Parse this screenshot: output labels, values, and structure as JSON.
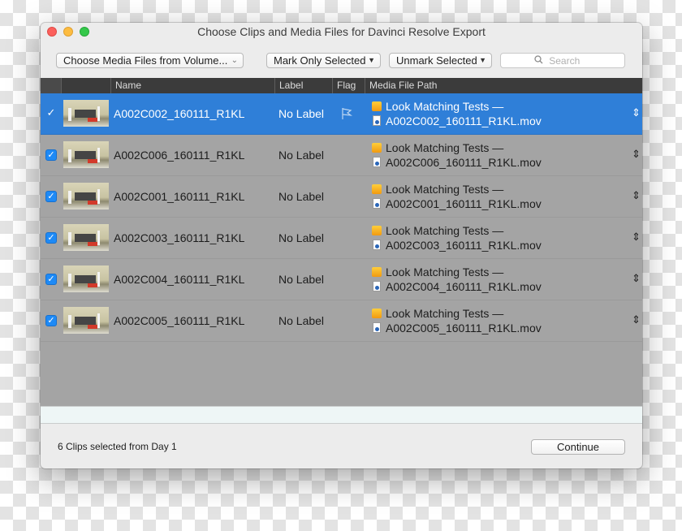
{
  "window": {
    "title": "Choose Clips and Media Files for Davinci Resolve Export"
  },
  "toolbar": {
    "media_dropdown_label": "Choose Media Files from Volume...",
    "mark_label": "Mark Only Selected",
    "unmark_label": "Unmark Selected",
    "search_placeholder": "Search"
  },
  "columns": {
    "name": "Name",
    "label": "Label",
    "flag": "Flag",
    "path": "Media File Path"
  },
  "rows": [
    {
      "name": "A002C002_160111_R1KL",
      "label": "No Label",
      "folder": "Look Matching Tests —",
      "file": "A002C002_160111_R1KL.mov",
      "checked": true,
      "selected": true
    },
    {
      "name": "A002C006_160111_R1KL",
      "label": "No Label",
      "folder": "Look Matching Tests —",
      "file": "A002C006_160111_R1KL.mov",
      "checked": true,
      "selected": false
    },
    {
      "name": "A002C001_160111_R1KL",
      "label": "No Label",
      "folder": "Look Matching Tests —",
      "file": "A002C001_160111_R1KL.mov",
      "checked": true,
      "selected": false
    },
    {
      "name": "A002C003_160111_R1KL",
      "label": "No Label",
      "folder": "Look Matching Tests —",
      "file": "A002C003_160111_R1KL.mov",
      "checked": true,
      "selected": false
    },
    {
      "name": "A002C004_160111_R1KL",
      "label": "No Label",
      "folder": "Look Matching Tests —",
      "file": "A002C004_160111_R1KL.mov",
      "checked": true,
      "selected": false
    },
    {
      "name": "A002C005_160111_R1KL",
      "label": "No Label",
      "folder": "Look Matching Tests —",
      "file": "A002C005_160111_R1KL.mov",
      "checked": true,
      "selected": false
    }
  ],
  "footer": {
    "status": "6 Clips selected from Day 1",
    "continue_label": "Continue"
  },
  "colors": {
    "selection": "#2f7fd8",
    "checkbox": "#1e8af6",
    "list_background": "#a4a4a4",
    "header_background": "#3b3b3b"
  },
  "icons": {
    "search": "search-icon",
    "flag": "flag-icon",
    "folder": "folder-icon",
    "file": "movie-file-icon",
    "stepper": "stepper-icon"
  }
}
